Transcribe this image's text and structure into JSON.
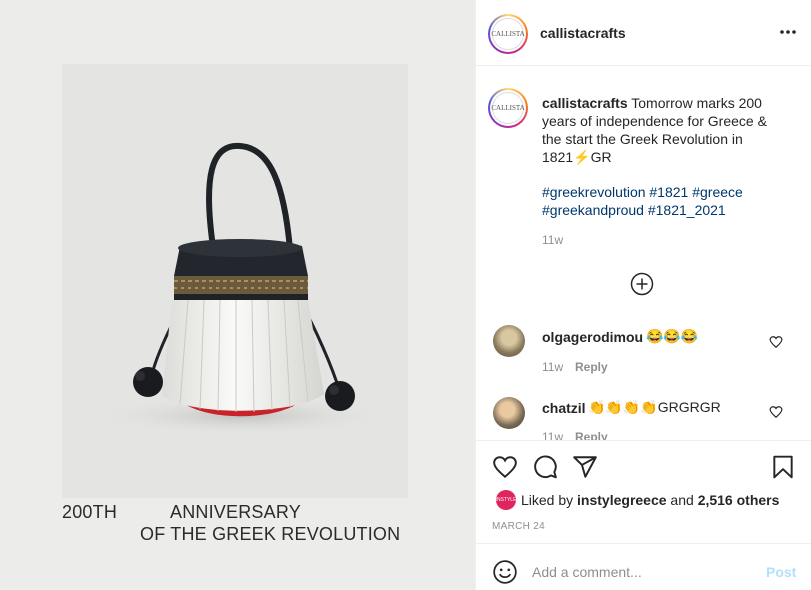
{
  "post": {
    "image_caption": {
      "line1_left": "200TH",
      "line1_right": "ANNIVERSARY",
      "line2": "OF THE GREEK  REVOLUTION"
    }
  },
  "header": {
    "avatar_text": "CALLISTA",
    "username": "callistacrafts",
    "more_icon": "more-horizontal-icon"
  },
  "caption": {
    "username": "callistacrafts",
    "text": "Tomorrow marks 200 years of independence for Greece & the start the Greek Revolution in 1821⚡GR",
    "hashtags": "#greekrevolution #1821 #greece #greekandproud #1821_2021",
    "time": "11w"
  },
  "comments": [
    {
      "username": "olgagerodimou",
      "text": "😂😂😂",
      "time": "11w",
      "reply": "Reply"
    },
    {
      "username": "chatzil",
      "text": "👏👏👏👏GRGRGR",
      "time": "11w",
      "reply": "Reply"
    }
  ],
  "actions": {
    "like_icon": "heart-icon",
    "comment_icon": "comment-icon",
    "share_icon": "send-icon",
    "save_icon": "bookmark-icon"
  },
  "likes": {
    "avatar_text": "INSTYLE",
    "prefix": "Liked by ",
    "user": "instylegreece",
    "middle": " and ",
    "count": "2,516 others"
  },
  "date": "MARCH 24",
  "add_comment": {
    "placeholder": "Add a comment...",
    "post_label": "Post"
  },
  "colors": {
    "link": "#00376b",
    "secondary": "#8e8e8e",
    "post_disabled": "#b2dffc"
  }
}
